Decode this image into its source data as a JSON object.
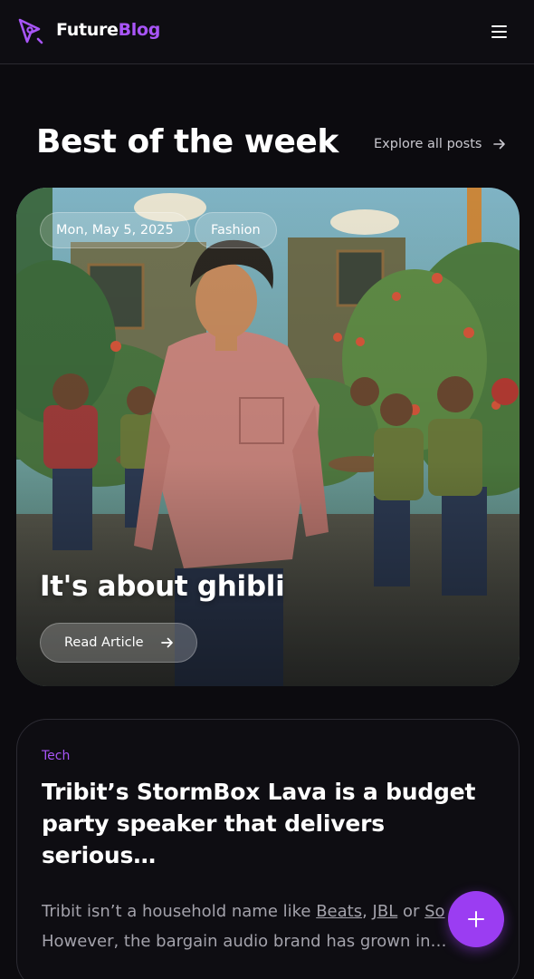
{
  "header": {
    "brand_part1": "Future",
    "brand_part2": "Blog",
    "logo_icon": "pen-nib-icon",
    "menu_icon": "hamburger-menu-icon",
    "accent_color": "#a855f7"
  },
  "section": {
    "title": "Best of the week",
    "explore_label": "Explore all posts",
    "explore_icon": "arrow-right-icon"
  },
  "hero": {
    "date": "Mon, May 5, 2025",
    "category": "Fashion",
    "title": "It's about ghibli",
    "cta_label": "Read Article",
    "cta_icon": "arrow-right-icon",
    "image_description_icon": "ghibli-style-illustration"
  },
  "post": {
    "category": "Tech",
    "title_line1": "Tribit’s StormBox Lava is a budget",
    "title_line2": "party speaker that delivers serious…",
    "excerpt_prefix": "Tribit isn’t a household name like ",
    "link_beats": "Beats",
    "link_jbl": "JBL",
    "excerpt_or": " or ",
    "link_sonos": "So",
    "excerpt_line2": "However, the bargain audio brand has grown in…"
  },
  "fab": {
    "icon": "plus-icon",
    "color": "#9b3df2"
  }
}
